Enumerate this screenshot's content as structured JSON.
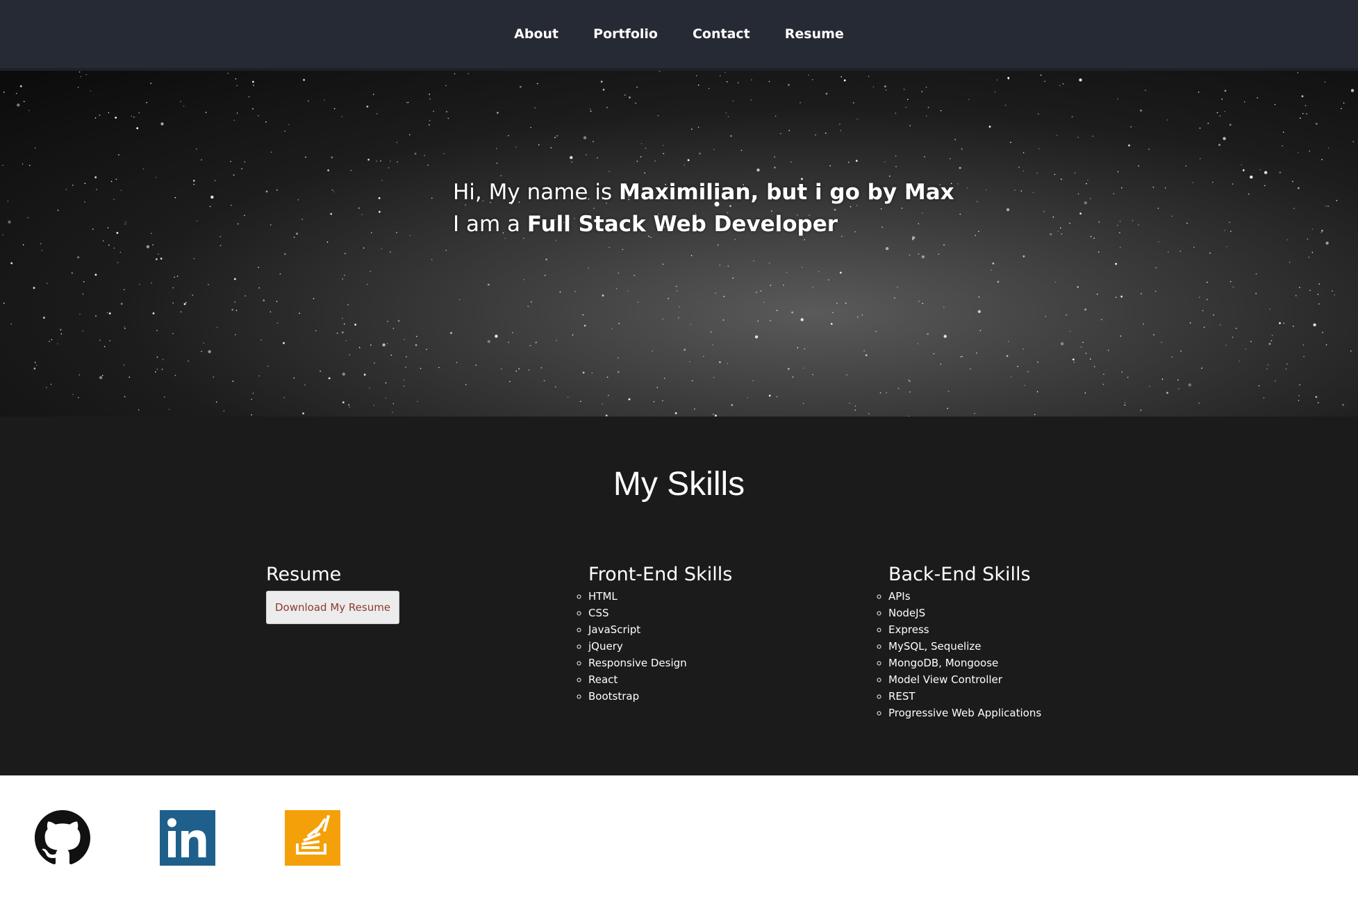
{
  "nav": {
    "items": [
      "About",
      "Portfolio",
      "Contact",
      "Resume"
    ]
  },
  "hero": {
    "line1_prefix": "Hi, My name is ",
    "line1_bold": "Maximilian, but i go by Max",
    "line2_prefix": "I am a ",
    "line2_bold": "Full Stack Web Developer"
  },
  "skills": {
    "title": "My Skills",
    "resume": {
      "heading": "Resume",
      "button_label": "Download My Resume"
    },
    "frontend": {
      "heading": "Front-End Skills",
      "items": [
        "HTML",
        "CSS",
        "JavaScript",
        "jQuery",
        "Responsive Design",
        "React",
        "Bootstrap"
      ]
    },
    "backend": {
      "heading": "Back-End Skills",
      "items": [
        "APIs",
        "NodeJS",
        "Express",
        "MySQL, Sequelize",
        "MongoDB, Mongoose",
        "Model View Controller",
        "REST",
        "Progressive Web Applications"
      ]
    }
  },
  "footer": {
    "icons": [
      "github-icon",
      "linkedin-icon",
      "stackoverflow-icon"
    ]
  },
  "colors": {
    "navbar": "#262a34",
    "skills_bg": "#1b1b1c",
    "linkedin": "#1f5f8b",
    "stackoverflow": "#f4a008",
    "button_text": "#8b3a2e"
  }
}
